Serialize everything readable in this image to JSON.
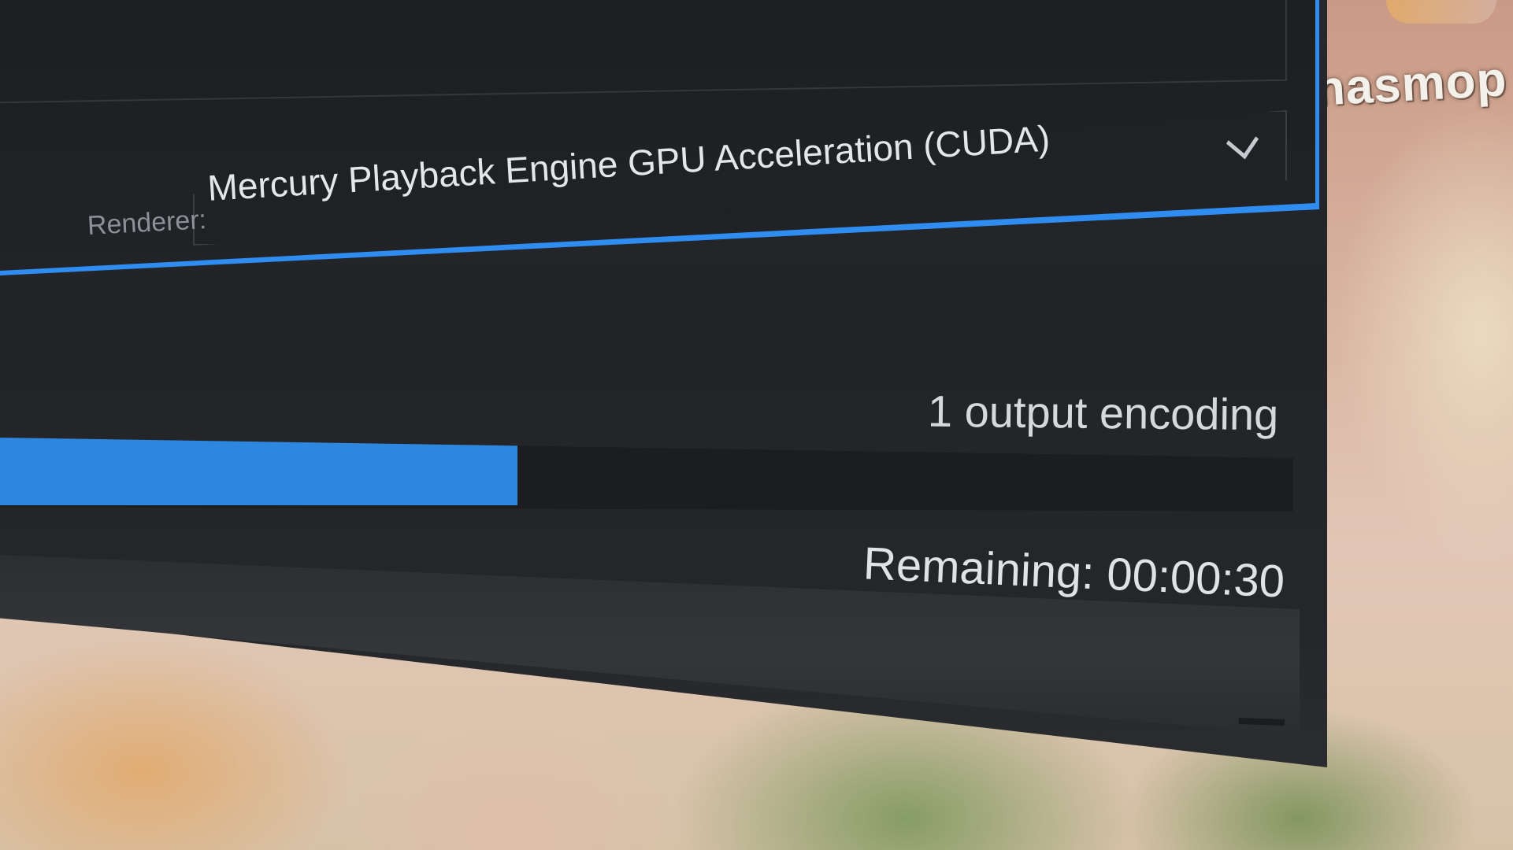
{
  "wallpaper": {
    "text": "hasmop"
  },
  "dialog": {
    "renderer": {
      "label": "Renderer:",
      "value": "Mercury Playback Engine GPU Acceleration (CUDA)"
    },
    "status": {
      "encoding_text": "1 output encoding",
      "remaining_text": "Remaining: 00:00:30"
    },
    "progress": {
      "fraction": 0.4,
      "color": "#2e87df"
    },
    "accent_color": "#2f8cf0"
  }
}
